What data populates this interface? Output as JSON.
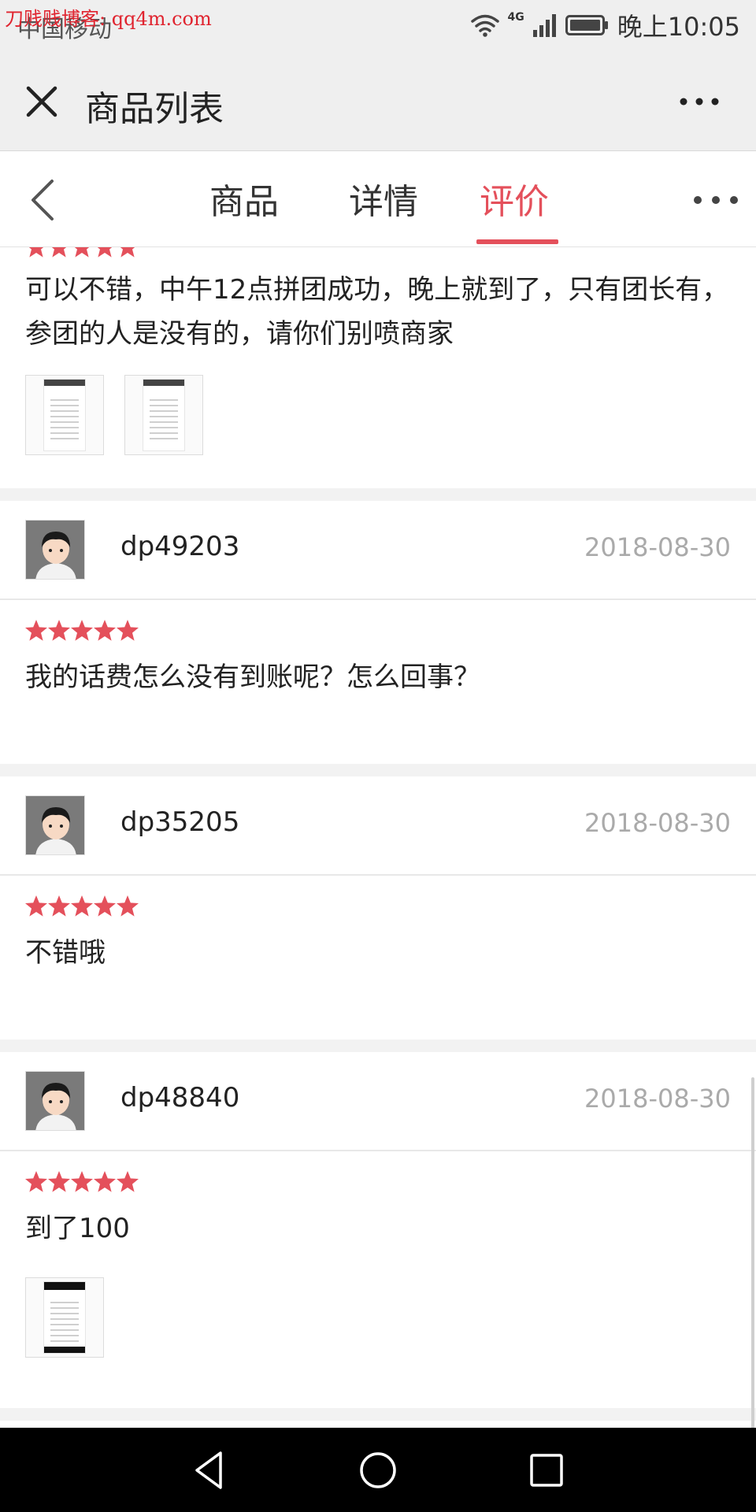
{
  "status_bar": {
    "carrier": "中国移动",
    "watermark": "刀贱贱博客: qq4m.com",
    "network": "4G",
    "time": "晚上10:05"
  },
  "title_bar": {
    "title": "商品列表",
    "close_icon": "close-icon",
    "more_icon": "more-horizontal-icon"
  },
  "tabs": [
    {
      "label": "商品",
      "active": false
    },
    {
      "label": "详情",
      "active": false
    },
    {
      "label": "评价",
      "active": true
    }
  ],
  "accent_color": "#e4505b",
  "reviews": [
    {
      "text": "可以不错，中午12点拼团成功，晚上就到了，只有团长有，参团的人是没有的，请你们别喷商家",
      "rating": 5,
      "images": 2
    },
    {
      "username": "dp49203",
      "date": "2018-08-30",
      "rating": 5,
      "text": "我的话费怎么没有到账呢？怎么回事？",
      "images": 0
    },
    {
      "username": "dp35205",
      "date": "2018-08-30",
      "rating": 5,
      "text": "不错哦",
      "images": 0
    },
    {
      "username": "dp48840",
      "date": "2018-08-30",
      "rating": 5,
      "text": "到了100",
      "images": 1
    }
  ],
  "nav_bar": {
    "back_icon": "triangle-back-icon",
    "home_icon": "circle-home-icon",
    "recent_icon": "square-recent-icon"
  }
}
